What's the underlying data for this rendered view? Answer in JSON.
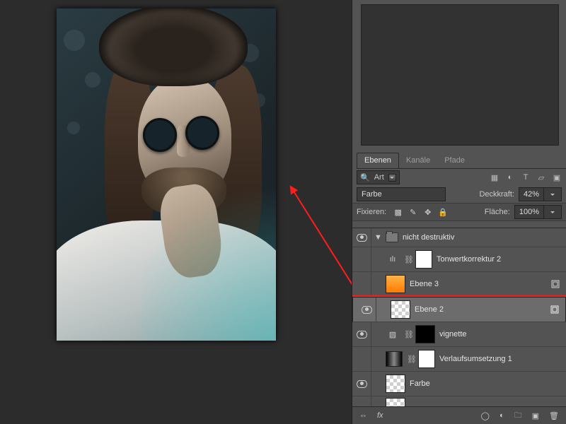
{
  "tabs": {
    "layers": "Ebenen",
    "channels": "Kanäle",
    "paths": "Pfade"
  },
  "filter": {
    "label": "Art"
  },
  "blend": {
    "mode": "Farbe",
    "opacity_label": "Deckkraft:",
    "opacity_value": "42%"
  },
  "lock": {
    "label": "Fixieren:",
    "fill_label": "Fläche:",
    "fill_value": "100%"
  },
  "group": {
    "name": "nicht destruktiv"
  },
  "layers": [
    {
      "name": "Tonwertkorrektur 2"
    },
    {
      "name": "Ebene 3"
    },
    {
      "name": "Ebene 2"
    },
    {
      "name": "vignette"
    },
    {
      "name": "Verlaufsumsetzung 1"
    },
    {
      "name": "Farbe"
    }
  ]
}
